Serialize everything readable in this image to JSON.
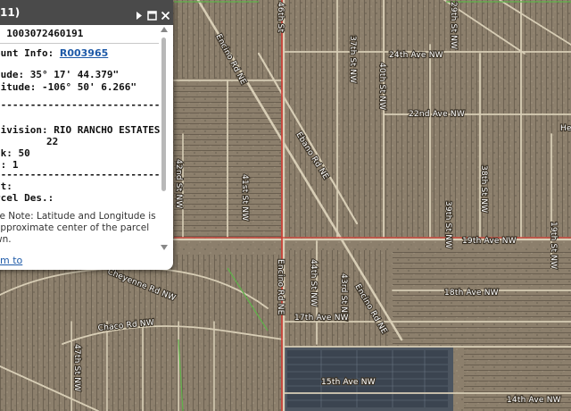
{
  "map": {
    "road_labels": [
      "Encino Rd NE",
      "46th St",
      "29th St NW",
      "24th Ave NW",
      "37th St NW",
      "22nd Ave NW",
      "Ebano Rd NE",
      "42nd St NW",
      "41st St NW",
      "40th St NW",
      "He",
      "38th St NW",
      "39th St NW",
      "19th Ave NW",
      "19th St NW",
      "18th Ave NW",
      "Encino Rd NE",
      "44th St NW",
      "43rd St NW",
      "17th Ave NW",
      "Encino Rd NE",
      "15th Ave NW",
      "14th Ave NW",
      "47th St NW",
      "Cheyenne Rd NW",
      "Chaco Rd NW"
    ]
  },
  "popup": {
    "title": "11)",
    "lines": {
      "parcel_id": ": 1003072460191",
      "account_label": "ount Info:",
      "account_link": "R003965",
      "latitude": "tude: 35° 17' 44.379\"",
      "longitude": "gitude: -106° 50' 6.266\"",
      "sep1": "--------------------------------",
      "subdivision": "division: RIO RANCHO ESTATES",
      "unit": "22",
      "block": "ck:          50",
      "lot": "t:            1",
      "sep2": "--------------------------------",
      "district": "ct:",
      "parcel_des": "rcel Des.:",
      "note1": "se Note: Latitude and Longitude is",
      "note2": "approximate center of the parcel",
      "note3": "wn."
    },
    "zoom_link": "m to",
    "icons": [
      "play-icon",
      "minimize-icon",
      "close-icon"
    ]
  }
}
